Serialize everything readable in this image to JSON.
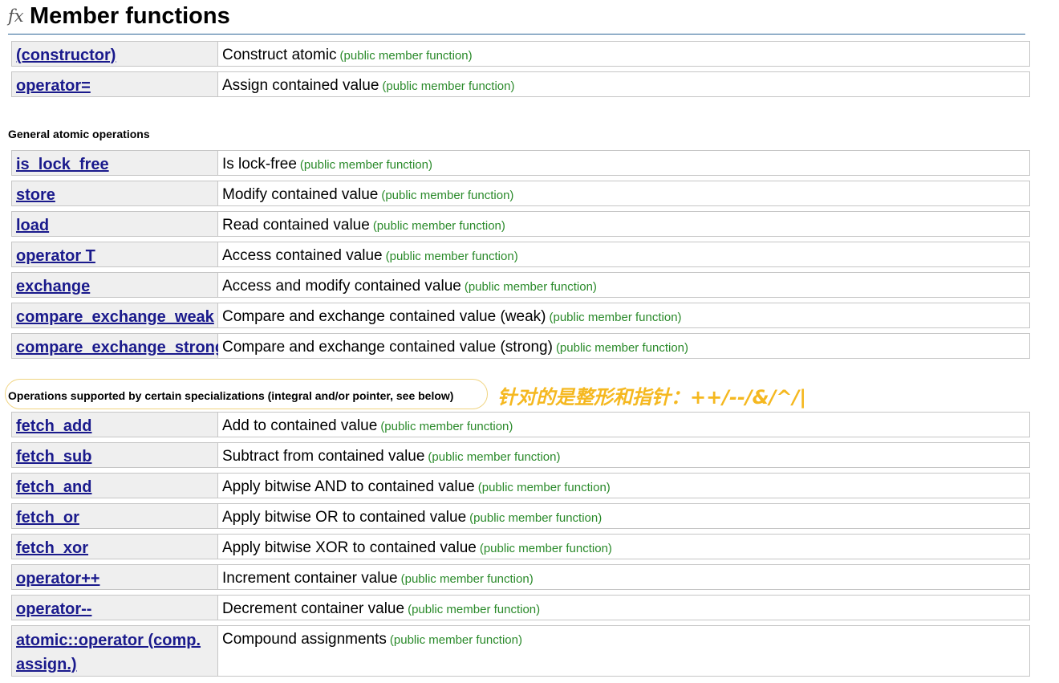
{
  "header": {
    "icon": "fx-icon",
    "icon_glyph": "fx",
    "title": "Member functions"
  },
  "kind_label": "(public member function)",
  "groups": [
    {
      "heading": "",
      "rows": [
        {
          "name": "(constructor)",
          "desc": "Construct atomic"
        },
        {
          "name": "operator=",
          "desc": "Assign contained value"
        }
      ]
    },
    {
      "heading": "General atomic operations",
      "rows": [
        {
          "name": "is_lock_free",
          "desc": "Is lock-free"
        },
        {
          "name": "store",
          "desc": "Modify contained value"
        },
        {
          "name": "load",
          "desc": "Read contained value"
        },
        {
          "name": "operator T",
          "desc": "Access contained value"
        },
        {
          "name": "exchange",
          "desc": "Access and modify contained value"
        },
        {
          "name": "compare_exchange_weak",
          "desc": "Compare and exchange contained value (weak)"
        },
        {
          "name": "compare_exchange_strong",
          "desc": "Compare and exchange contained value (strong)"
        }
      ]
    },
    {
      "heading": "Operations supported by certain specializations (integral and/or pointer, see below)",
      "annotation": "针对的是整形和指针：++/--/&/^/|",
      "rows": [
        {
          "name": "fetch_add",
          "desc": "Add to contained value"
        },
        {
          "name": "fetch_sub",
          "desc": "Subtract from contained value"
        },
        {
          "name": "fetch_and",
          "desc": "Apply bitwise AND to contained value"
        },
        {
          "name": "fetch_or",
          "desc": "Apply bitwise OR to contained value"
        },
        {
          "name": "fetch_xor",
          "desc": "Apply bitwise XOR to contained value"
        },
        {
          "name": "operator++",
          "desc": "Increment container value"
        },
        {
          "name": "operator--",
          "desc": "Decrement container value"
        },
        {
          "name": "atomic::operator (comp. assign.)",
          "desc": "Compound assignments"
        }
      ]
    }
  ],
  "colors": {
    "link": "#1a1a8c",
    "kind": "#2a8a2a",
    "annotation": "#f5b820",
    "name_cell_bg": "#efefef"
  }
}
